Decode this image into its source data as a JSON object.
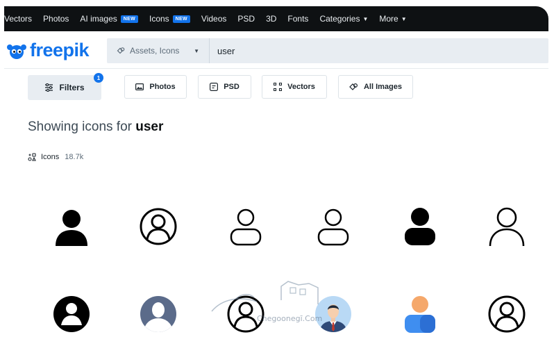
{
  "topnav": {
    "items": [
      {
        "label": "Vectors"
      },
      {
        "label": "Photos"
      },
      {
        "label": "AI images",
        "badge": "NEW"
      },
      {
        "label": "Icons",
        "badge": "NEW"
      },
      {
        "label": "Videos"
      },
      {
        "label": "PSD"
      },
      {
        "label": "3D"
      },
      {
        "label": "Fonts"
      },
      {
        "label": "Categories",
        "dropdown": true
      },
      {
        "label": "More",
        "dropdown": true
      }
    ]
  },
  "header": {
    "logo_text": "freepik",
    "search_type": "Assets, Icons",
    "search_value": "user"
  },
  "filters": {
    "filters_label": "Filters",
    "filters_count": "1",
    "photos_label": "Photos",
    "psd_label": "PSD",
    "vectors_label": "Vectors",
    "all_images_label": "All Images"
  },
  "results": {
    "heading_prefix": "Showing icons for",
    "query": "user",
    "type_label": "Icons",
    "count": "18.7k"
  },
  "watermark": {
    "text": "Chegoonegī.Com"
  },
  "colors": {
    "brand": "#1273eb",
    "nav_bg": "#0e1113",
    "search_bg": "#e8edf2"
  },
  "icons": [
    "user-solid-icon",
    "user-circle-outline-icon",
    "user-outline-icon",
    "user-outline-icon",
    "user-solid-rounded-icon",
    "user-thin-outline-icon",
    "user-circle-solid-icon",
    "user-avatar-placeholder-icon",
    "user-circle-outline-icon",
    "businessman-avatar-icon",
    "user-colored-icon",
    "user-circle-outline-icon"
  ]
}
